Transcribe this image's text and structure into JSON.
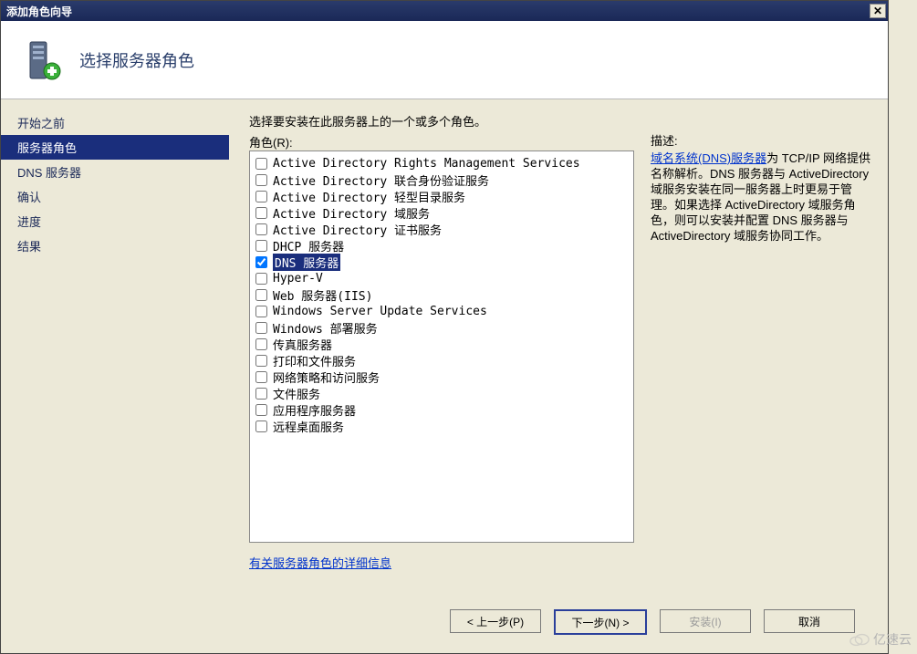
{
  "window": {
    "title": "添加角色向导"
  },
  "header": {
    "page_title": "选择服务器角色"
  },
  "sidebar": {
    "items": [
      {
        "label": "开始之前",
        "selected": false
      },
      {
        "label": "服务器角色",
        "selected": true
      },
      {
        "label": "DNS 服务器",
        "selected": false
      },
      {
        "label": "确认",
        "selected": false
      },
      {
        "label": "进度",
        "selected": false
      },
      {
        "label": "结果",
        "selected": false
      }
    ]
  },
  "main": {
    "instruction": "选择要安装在此服务器上的一个或多个角色。",
    "roles_label": "角色(R):",
    "roles": [
      {
        "label": "Active Directory Rights Management Services",
        "checked": false,
        "selected": false
      },
      {
        "label": "Active Directory 联合身份验证服务",
        "checked": false,
        "selected": false
      },
      {
        "label": "Active Directory 轻型目录服务",
        "checked": false,
        "selected": false
      },
      {
        "label": "Active Directory 域服务",
        "checked": false,
        "selected": false
      },
      {
        "label": "Active Directory 证书服务",
        "checked": false,
        "selected": false
      },
      {
        "label": "DHCP 服务器",
        "checked": false,
        "selected": false
      },
      {
        "label": "DNS 服务器",
        "checked": true,
        "selected": true
      },
      {
        "label": "Hyper-V",
        "checked": false,
        "selected": false
      },
      {
        "label": "Web 服务器(IIS)",
        "checked": false,
        "selected": false
      },
      {
        "label": "Windows Server Update Services",
        "checked": false,
        "selected": false
      },
      {
        "label": "Windows 部署服务",
        "checked": false,
        "selected": false
      },
      {
        "label": "传真服务器",
        "checked": false,
        "selected": false
      },
      {
        "label": "打印和文件服务",
        "checked": false,
        "selected": false
      },
      {
        "label": "网络策略和访问服务",
        "checked": false,
        "selected": false
      },
      {
        "label": "文件服务",
        "checked": false,
        "selected": false
      },
      {
        "label": "应用程序服务器",
        "checked": false,
        "selected": false
      },
      {
        "label": "远程桌面服务",
        "checked": false,
        "selected": false
      }
    ],
    "description": {
      "heading": "描述:",
      "link": "域名系统(DNS)服务器",
      "body": "为 TCP/IP 网络提供名称解析。DNS 服务器与 ActiveDirectory 域服务安装在同一服务器上时更易于管理。如果选择 ActiveDirectory 域服务角色，则可以安装并配置 DNS 服务器与 ActiveDirectory 域服务协同工作。"
    },
    "more_link": "有关服务器角色的详细信息"
  },
  "buttons": {
    "back": "< 上一步(P)",
    "next_text": "下一步(N) >",
    "install": "安装(I)",
    "cancel": "取消"
  },
  "watermark": "亿速云"
}
